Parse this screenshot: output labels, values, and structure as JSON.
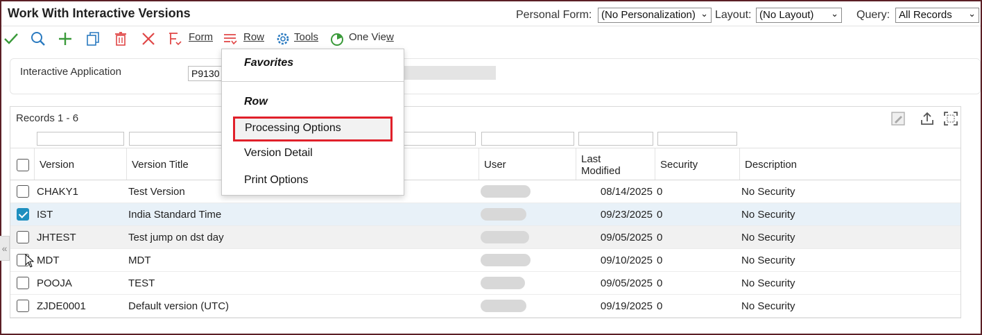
{
  "window": {
    "title": "Work With Interactive Versions",
    "personal_form_label": "Personal Form:",
    "personal_form_value": "(No Personalization)",
    "layout_label": "Layout:",
    "layout_value": "(No Layout)",
    "query_label": "Query:",
    "query_value": "All Records"
  },
  "toolbar": {
    "form_label": "Form",
    "row_label": "Row",
    "tools_label": "Tools",
    "oneview_label_pre": "One Vie",
    "oneview_label_u": "w",
    "icons": [
      "check-icon",
      "search-icon",
      "add-icon",
      "copy-icon",
      "delete-icon",
      "close-icon",
      "form-icon",
      "row-icon",
      "gear-icon",
      "oneview-icon"
    ]
  },
  "criteria": {
    "label": "Interactive Application",
    "value": "P9130"
  },
  "grid": {
    "records_text": "Records 1 - 6",
    "columns": [
      "Version",
      "Version Title",
      "User",
      "Last Modified",
      "Security",
      "Description"
    ],
    "rows": [
      {
        "version": "CHAKY1",
        "title": "Test Version",
        "modified": "08/14/2025",
        "security": "0",
        "description": "No Security",
        "checked": false
      },
      {
        "version": "IST",
        "title": "India Standard Time",
        "modified": "09/23/2025",
        "security": "0",
        "description": "No Security",
        "checked": true
      },
      {
        "version": "JHTEST",
        "title": "Test jump on dst day",
        "modified": "09/05/2025",
        "security": "0",
        "description": "No Security",
        "checked": false
      },
      {
        "version": "MDT",
        "title": "MDT",
        "modified": "09/10/2025",
        "security": "0",
        "description": "No Security",
        "checked": false
      },
      {
        "version": "POOJA",
        "title": "TEST",
        "modified": "09/05/2025",
        "security": "0",
        "description": "No Security",
        "checked": false
      },
      {
        "version": "ZJDE0001",
        "title": "Default version (UTC)",
        "modified": "09/19/2025",
        "security": "0",
        "description": "No Security",
        "checked": false
      }
    ]
  },
  "row_menu": {
    "favorites_header": "Favorites",
    "row_header": "Row",
    "items": [
      "Processing Options",
      "Version Detail",
      "Print Options"
    ],
    "highlight_color": "#e0202a"
  },
  "colors": {
    "accent": "#1e8fbf",
    "frame": "#5a1f25"
  }
}
